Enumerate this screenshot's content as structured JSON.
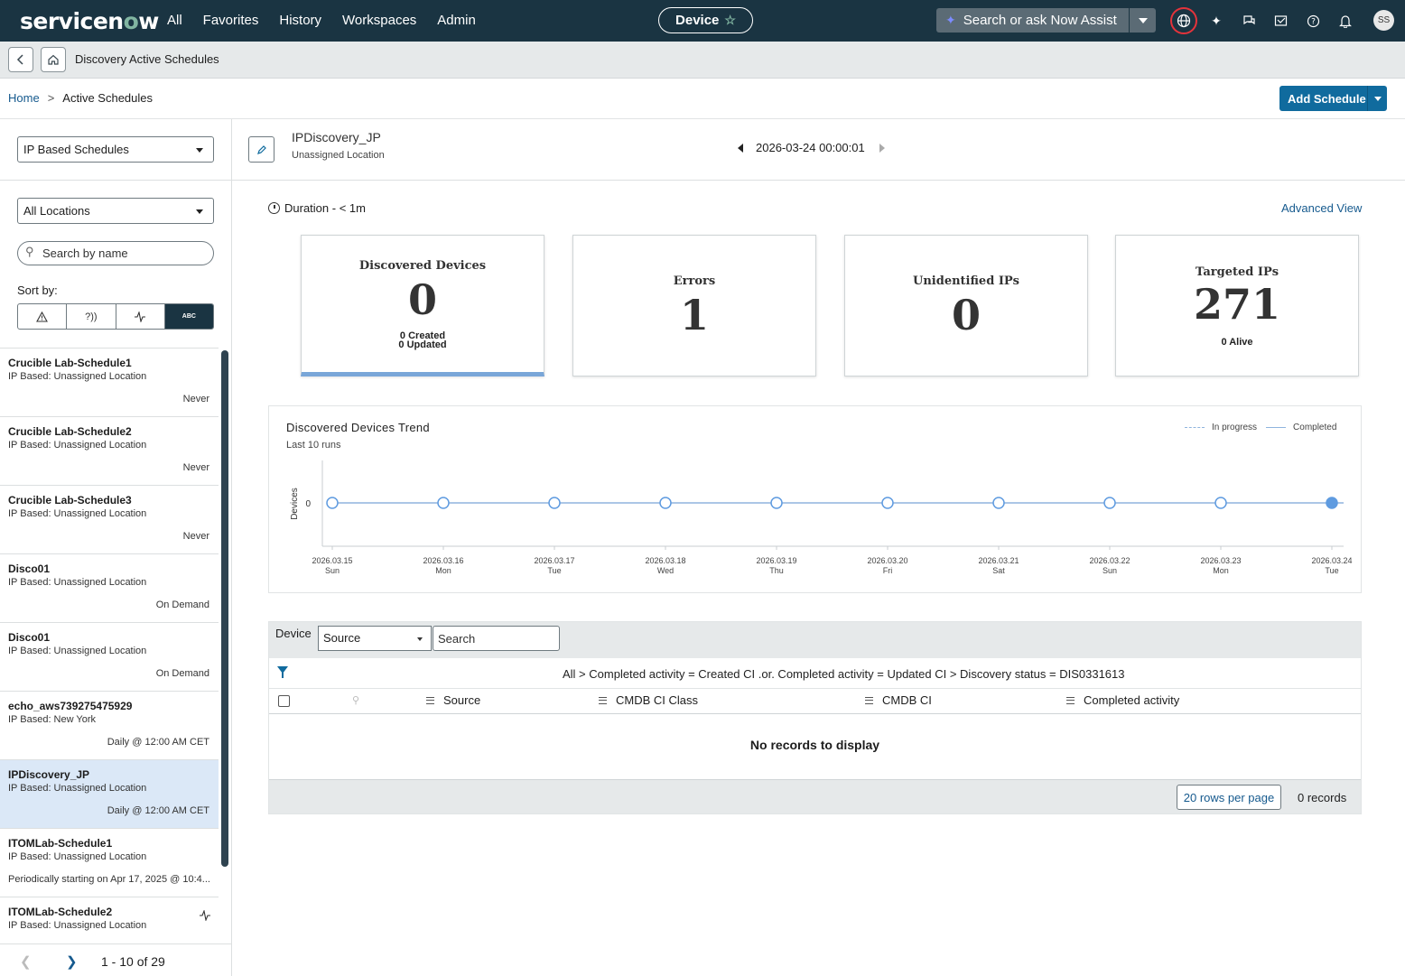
{
  "topbar": {
    "logo_text": "servicenow",
    "nav": [
      "All",
      "Favorites",
      "History",
      "Workspaces",
      "Admin"
    ],
    "context_pill": "Device",
    "search_placeholder": "Search or ask Now Assist",
    "avatar_initials": "SS",
    "icons": [
      "globe-icon",
      "sparkle-icon",
      "chat-icon",
      "inbox-icon",
      "help-icon",
      "bell-icon"
    ],
    "colors": {
      "bar": "#1a3442",
      "accent": "#81b5a1",
      "alert": "#e4333b"
    }
  },
  "subbar": {
    "title": "Discovery Active Schedules"
  },
  "breadcrumb": {
    "home": "Home",
    "separator": ">",
    "current": "Active Schedules"
  },
  "add_schedule": {
    "label": "Add Schedule"
  },
  "sidebar": {
    "schedule_type": "IP Based Schedules",
    "location": "All Locations",
    "search_placeholder": "Search by name",
    "sort_label": "Sort by:",
    "sort_options": [
      "warning-icon",
      "unidentified-icon",
      "pulse-icon",
      "ABC"
    ],
    "sort_selected": "ABC",
    "items": [
      {
        "name": "Crucible Lab-Schedule1",
        "location": "IP Based: Unassigned Location",
        "schedule": "Never"
      },
      {
        "name": "Crucible Lab-Schedule2",
        "location": "IP Based: Unassigned Location",
        "schedule": "Never"
      },
      {
        "name": "Crucible Lab-Schedule3",
        "location": "IP Based: Unassigned Location",
        "schedule": "Never"
      },
      {
        "name": "Disco01",
        "location": "IP Based: Unassigned Location",
        "schedule": "On Demand"
      },
      {
        "name": "Disco01",
        "location": "IP Based: Unassigned Location",
        "schedule": "On Demand"
      },
      {
        "name": "echo_aws739275475929",
        "location": "IP Based: New York",
        "schedule": "Daily @ 12:00 AM CET"
      },
      {
        "name": "IPDiscovery_JP",
        "location": "IP Based: Unassigned Location",
        "schedule": "Daily @ 12:00 AM CET",
        "selected": true
      },
      {
        "name": "ITOMLab-Schedule1",
        "location": "IP Based: Unassigned Location",
        "schedule": "Periodically starting on Apr 17, 2025 @ 10:4..."
      },
      {
        "name": "ITOMLab-Schedule2",
        "location": "IP Based: Unassigned Location",
        "schedule": ""
      }
    ],
    "pagination": "1 - 10 of 29"
  },
  "detail": {
    "schedule_name": "IPDiscovery_JP",
    "schedule_location": "Unassigned Location",
    "run_datetime": "2026-03-24 00:00:01",
    "duration": "Duration - < 1m",
    "advanced_view": "Advanced View",
    "cards": [
      {
        "title": "Discovered Devices",
        "value": "0",
        "sub1": "0 Created",
        "sub2": "0 Updated"
      },
      {
        "title": "Errors",
        "value": "1"
      },
      {
        "title": "Unidentified IPs",
        "value": "0"
      },
      {
        "title": "Targeted IPs",
        "value": "271",
        "sub1": "0 Alive"
      }
    ]
  },
  "chart_data": {
    "type": "line",
    "title": "Discovered Devices Trend",
    "subtitle": "Last 10 runs",
    "ylabel": "Devices",
    "x": [
      "2026.03.15",
      "2026.03.16",
      "2026.03.17",
      "2026.03.18",
      "2026.03.19",
      "2026.03.20",
      "2026.03.21",
      "2026.03.22",
      "2026.03.23",
      "2026.03.24"
    ],
    "x_days": [
      "Sun",
      "Mon",
      "Tue",
      "Wed",
      "Thu",
      "Fri",
      "Sat",
      "Sun",
      "Mon",
      "Tue"
    ],
    "series": [
      {
        "name": "Completed",
        "values": [
          0,
          0,
          0,
          0,
          0,
          0,
          0,
          0,
          0,
          0
        ]
      }
    ],
    "legend": [
      "In progress",
      "Completed"
    ],
    "legend_position": "top-right",
    "yticks": [
      "0"
    ],
    "line_color": "#8fb4de",
    "highlight_color": "#5f9be0",
    "grid": false
  },
  "device_table": {
    "label": "Device",
    "source_select": "Source",
    "search_placeholder": "Search",
    "filter": "All > Completed activity = Created CI .or. Completed activity = Updated CI > Discovery status = DIS0331613",
    "columns": [
      "Source",
      "CMDB CI Class",
      "CMDB CI",
      "Completed activity"
    ],
    "empty": "No records to display",
    "rows_per_page": "20 rows per page",
    "record_count": "0 records"
  }
}
